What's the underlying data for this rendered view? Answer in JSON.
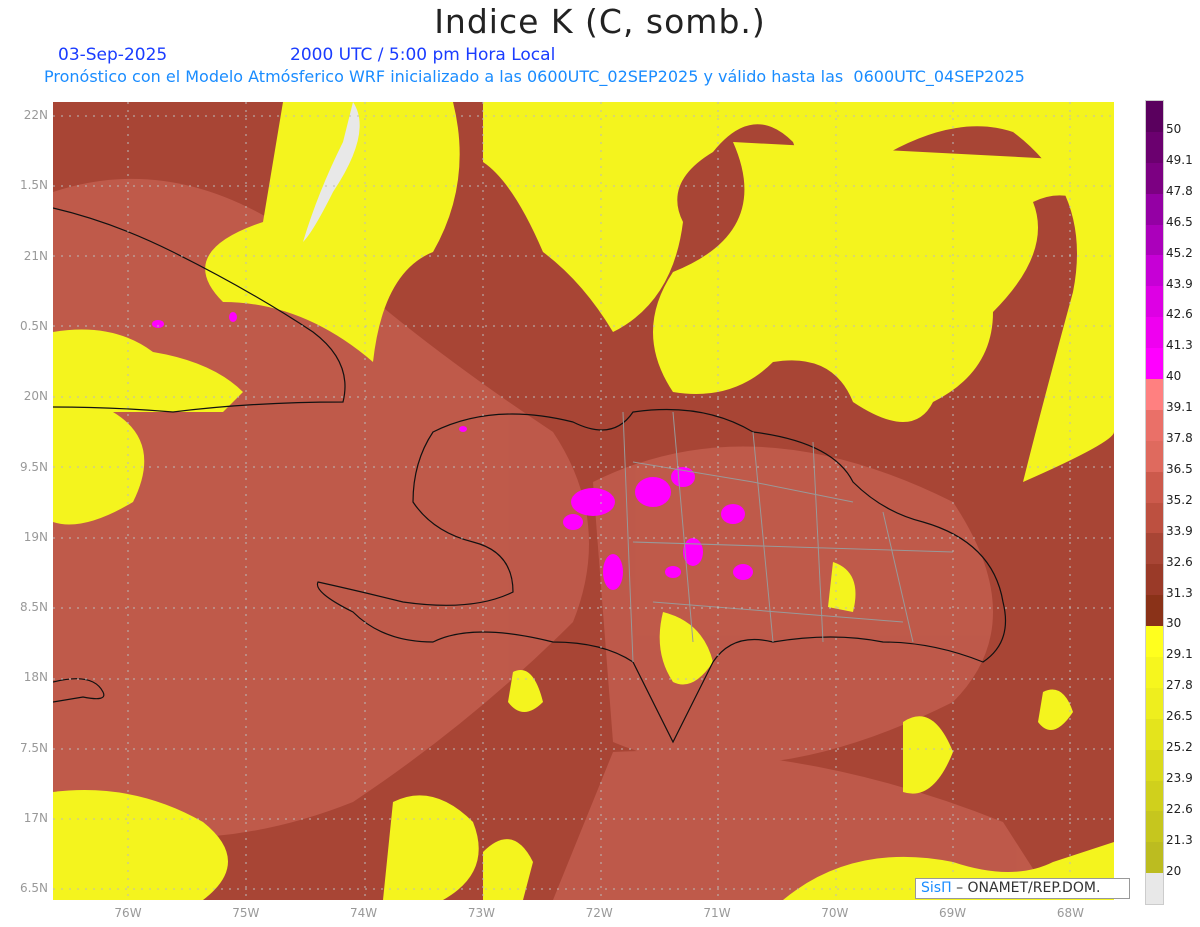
{
  "header": {
    "title": "Indice K (C, somb.)",
    "date": "03-Sep-2025",
    "time": "2000 UTC / 5:00 pm Hora Local",
    "subtitle": "Pronóstico con el Modelo Atmósferico WRF inicializado a las 0600UTC_02SEP2025 y válido hasta las  0600UTC_04SEP2025"
  },
  "axes": {
    "lat_labels": [
      "22N",
      "1.5N",
      "21N",
      "0.5N",
      "20N",
      "9.5N",
      "19N",
      "8.5N",
      "18N",
      "7.5N",
      "17N",
      "6.5N"
    ],
    "lon_labels": [
      "76W",
      "75W",
      "74W",
      "73W",
      "72W",
      "71W",
      "70W",
      "69W",
      "68W"
    ]
  },
  "colorbar": {
    "labels": [
      "50",
      "49.1",
      "47.8",
      "46.5",
      "45.2",
      "43.9",
      "42.6",
      "41.3",
      "40",
      "39.1",
      "37.8",
      "36.5",
      "35.2",
      "33.9",
      "32.6",
      "31.3",
      "30",
      "29.1",
      "27.8",
      "26.5",
      "25.2",
      "23.9",
      "22.6",
      "21.3",
      "20"
    ],
    "colors": [
      "#5a005e",
      "#6b006f",
      "#7c0082",
      "#9400a4",
      "#ab00bb",
      "#c600d6",
      "#dd00e4",
      "#ef00f0",
      "#ff00ff",
      "#ff8080",
      "#ea7068",
      "#df6a5e",
      "#cc5a4c",
      "#bd5040",
      "#a84535",
      "#9a3a28",
      "#8a3218",
      "#ffff1e",
      "#f6f61e",
      "#eeee1e",
      "#e4e41c",
      "#dada1c",
      "#d0d01c",
      "#c6c61e",
      "#bcbc20",
      "#e8e8e8"
    ]
  },
  "credit": {
    "logo": "SisΠ",
    "text": "– ONAMET/REP.DOM."
  }
}
